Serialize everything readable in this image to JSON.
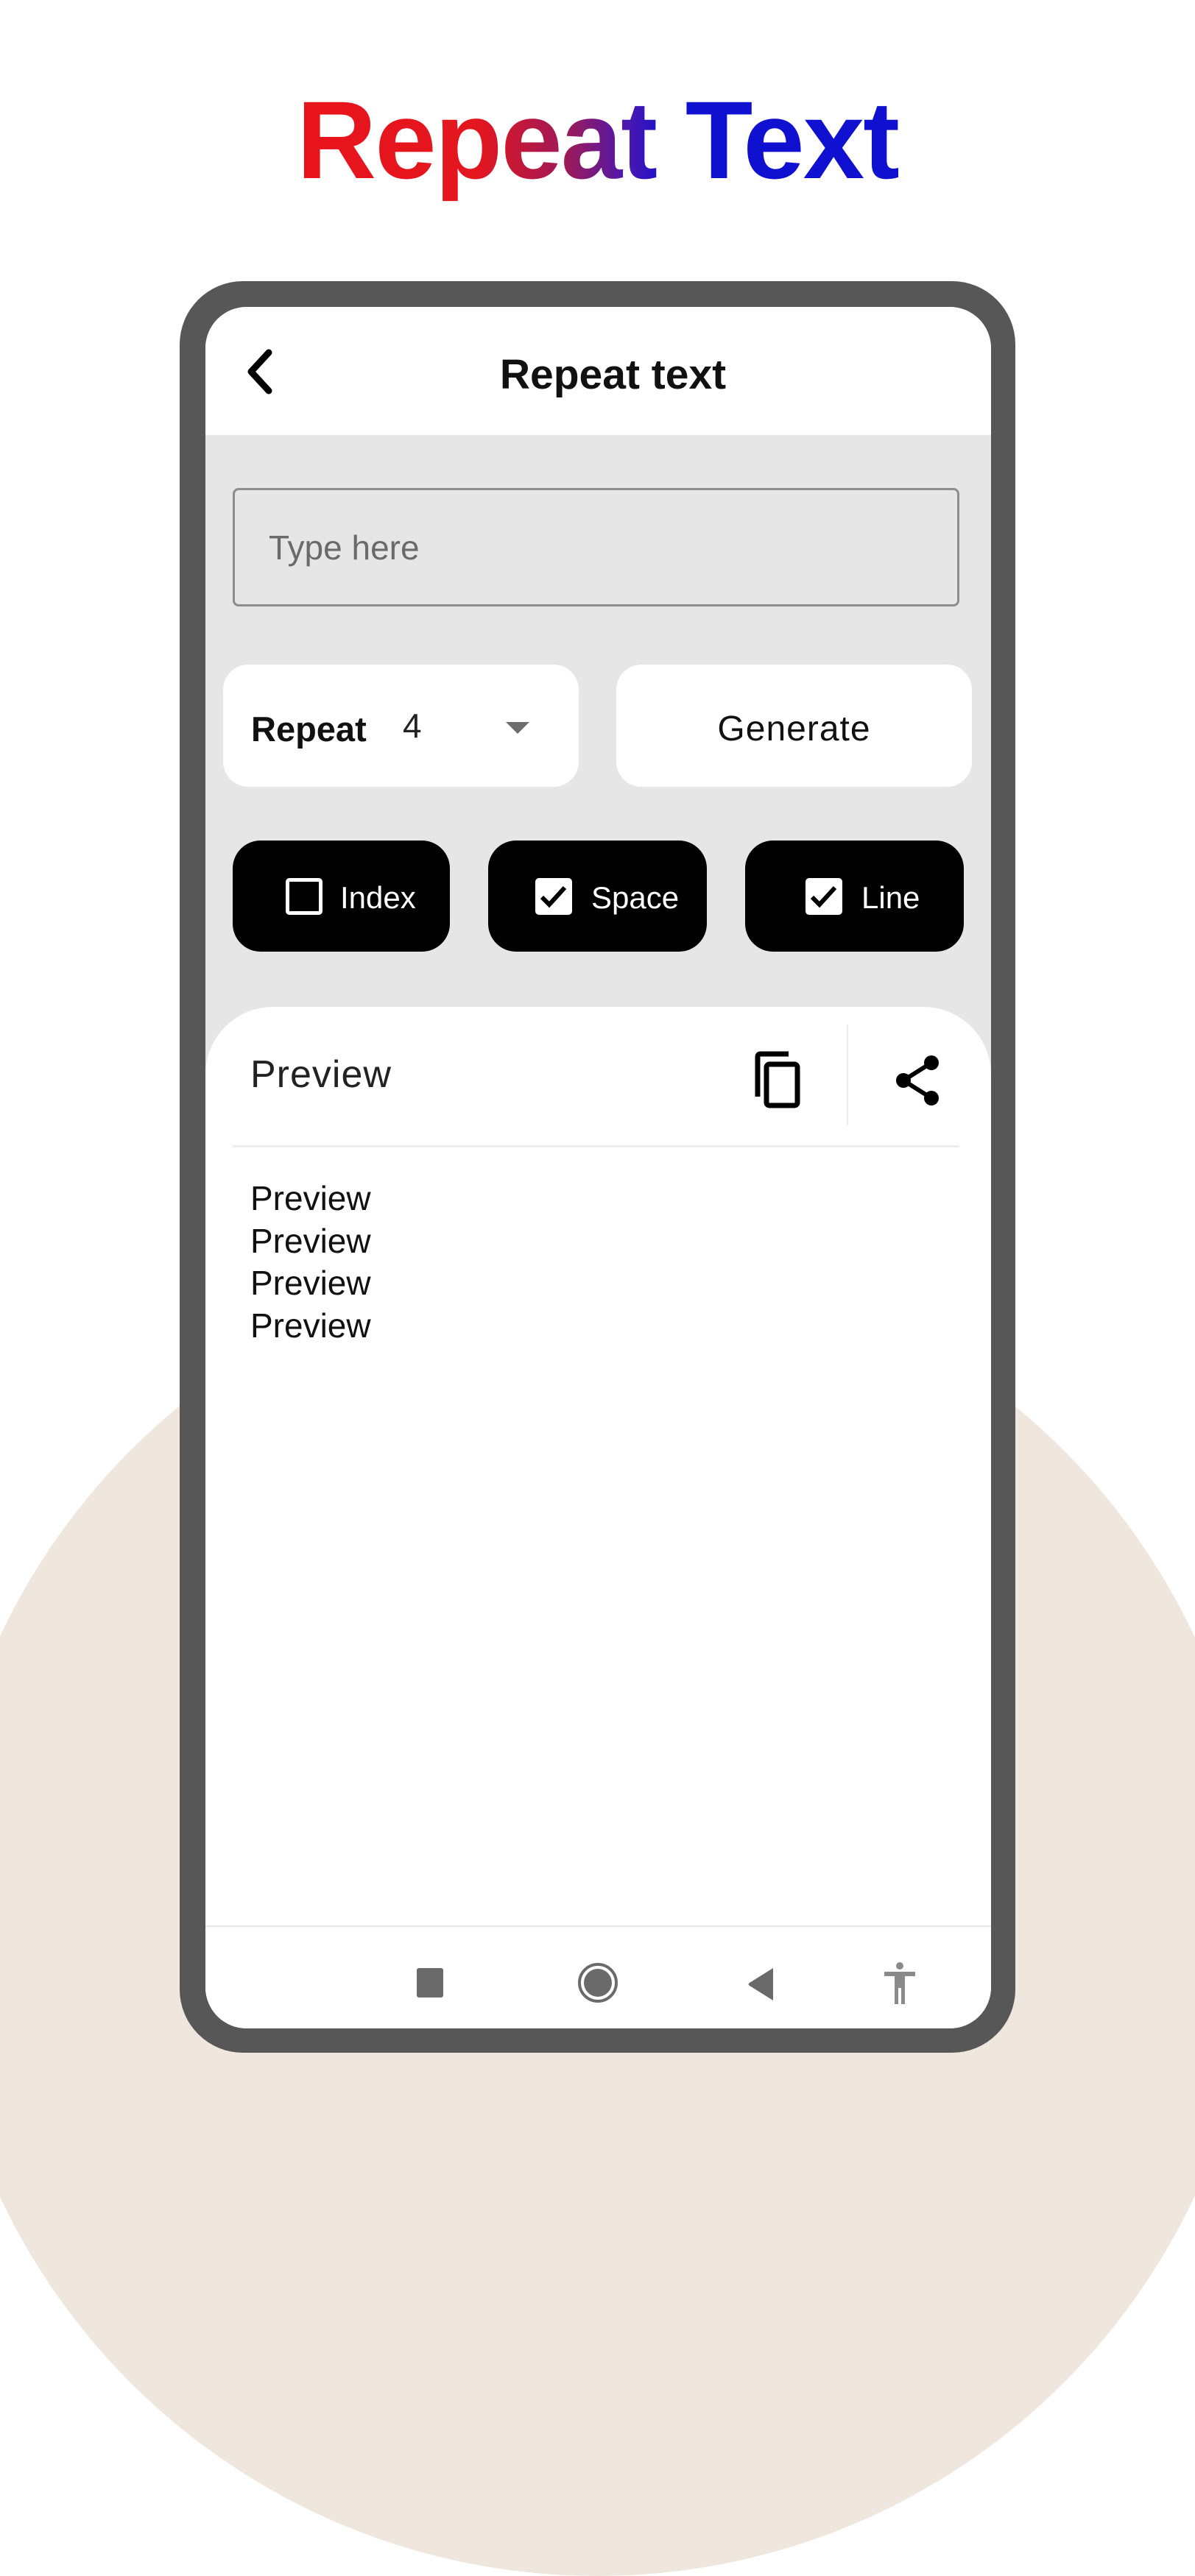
{
  "hero": {
    "title": "Repeat Text"
  },
  "appbar": {
    "title": "Repeat text",
    "back_icon": "chevron-left-icon"
  },
  "input": {
    "placeholder": "Type here",
    "value": ""
  },
  "repeat": {
    "label": "Repeat",
    "value": "4",
    "dropdown_icon": "caret-down-icon"
  },
  "generate": {
    "label": "Generate"
  },
  "options": [
    {
      "label": "Index",
      "checked": false
    },
    {
      "label": "Space",
      "checked": true
    },
    {
      "label": "Line",
      "checked": true
    }
  ],
  "preview": {
    "title": "Preview",
    "copy_icon": "copy-icon",
    "share_icon": "share-icon",
    "lines": [
      "Preview",
      "Preview",
      "Preview",
      "Preview"
    ]
  },
  "navbar": {
    "icons": [
      "recent-apps-icon",
      "home-icon",
      "back-icon",
      "accessibility-icon"
    ]
  },
  "colors": {
    "title_gradient_start": "#e8141c",
    "title_gradient_end": "#1010d0",
    "frame": "#575757",
    "content_bg": "#e6e6e6",
    "toggle_bg": "#000000",
    "backdrop": "#efe6dd"
  }
}
